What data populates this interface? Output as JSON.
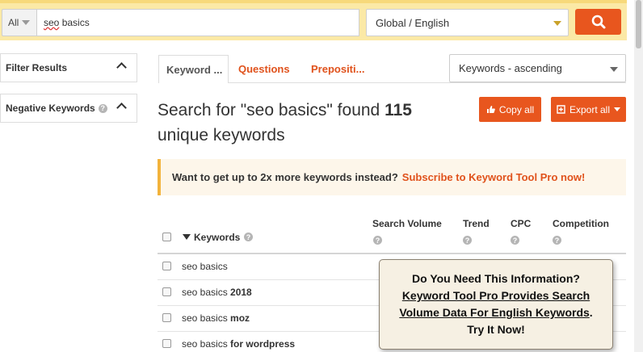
{
  "search": {
    "scope": "All",
    "query_first": "seo",
    "query_rest": " basics",
    "locale": "Global / English"
  },
  "sidebar": {
    "filter_label": "Filter Results",
    "negative_label": "Negative Keywords",
    "help_glyph": "?"
  },
  "tabs": [
    {
      "label": "Keyword ...",
      "active": true
    },
    {
      "label": "Questions",
      "active": false
    },
    {
      "label": "Prepositi...",
      "active": false
    }
  ],
  "sort": {
    "value": "Keywords - ascending"
  },
  "heading": {
    "prefix": "Search for \"seo basics\" found ",
    "count": "115",
    "suffix": "unique keywords"
  },
  "actions": {
    "copy_label": "Copy all",
    "export_label": "Export all"
  },
  "promo": {
    "text": "Want to get up to 2x more keywords instead?",
    "link": "Subscribe to Keyword Tool Pro now!"
  },
  "table": {
    "headers": {
      "keywords": "Keywords",
      "search_volume": "Search Volume",
      "trend": "Trend",
      "cpc": "CPC",
      "competition": "Competition"
    },
    "rows": [
      {
        "base": "seo basics",
        "suffix": ""
      },
      {
        "base": "seo basics ",
        "suffix": "2018"
      },
      {
        "base": "seo basics ",
        "suffix": "moz"
      },
      {
        "base": "seo basics ",
        "suffix": "for wordpress"
      }
    ]
  },
  "popup": {
    "line1": "Do You Need This Information?",
    "line2": "Keyword Tool Pro Provides Search",
    "line3": "Volume Data For English Keywords",
    "line3_end": ".",
    "line4": "Try It Now!"
  },
  "colors": {
    "accent": "#e8561e",
    "topbar": "#fbe9a6",
    "promo_border": "#f2b33c"
  }
}
